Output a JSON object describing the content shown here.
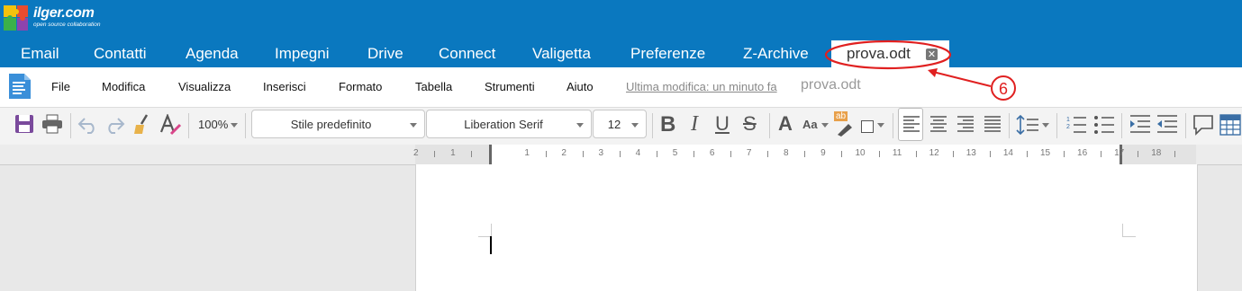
{
  "app": {
    "logo_name": "ilger.com",
    "logo_tagline": "open source collaboration"
  },
  "nav": {
    "tabs": [
      {
        "label": "Email"
      },
      {
        "label": "Contatti"
      },
      {
        "label": "Agenda"
      },
      {
        "label": "Impegni"
      },
      {
        "label": "Drive"
      },
      {
        "label": "Connect"
      },
      {
        "label": "Valigetta"
      },
      {
        "label": "Preferenze"
      },
      {
        "label": "Z-Archive"
      }
    ],
    "active_doc_tab": "prova.odt",
    "close_glyph": "✕"
  },
  "menu": {
    "items": [
      "File",
      "Modifica",
      "Visualizza",
      "Inserisci",
      "Formato",
      "Tabella",
      "Strumenti",
      "Aiuto"
    ],
    "last_modified": "Ultima modifica: un minuto fa",
    "document_name": "prova.odt"
  },
  "toolbar": {
    "zoom": "100%",
    "paragraph_style": "Stile predefinito",
    "font_name": "Liberation Serif",
    "font_size": "12",
    "bold_glyph": "B",
    "italic_glyph": "I",
    "underline_glyph": "U",
    "strike_glyph": "S",
    "grow_glyph": "A",
    "case_glyph": "Aa",
    "highlight_glyph": "ab"
  },
  "ruler": {
    "labels": [
      "2",
      "1",
      "1",
      "2",
      "3",
      "4",
      "5",
      "6",
      "7",
      "8",
      "9",
      "10",
      "11",
      "12",
      "13",
      "14",
      "15",
      "16",
      "17",
      "18"
    ]
  },
  "annotation": {
    "label": "6",
    "color": "#e02020"
  },
  "colors": {
    "brand": "#0a78bf"
  }
}
